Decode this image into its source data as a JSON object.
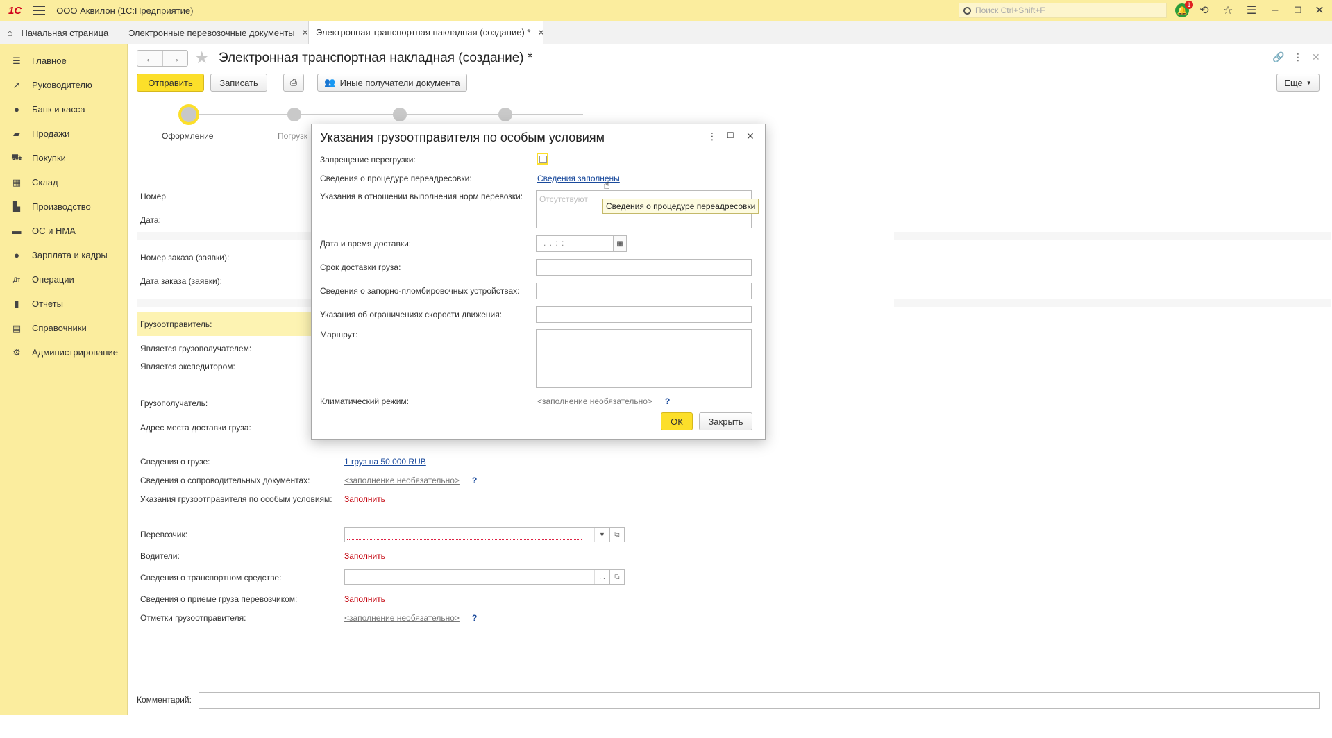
{
  "titlebar": {
    "logo": "1С",
    "app_title": "ООО Аквилон  (1С:Предприятие)",
    "search_placeholder": "Поиск Ctrl+Shift+F",
    "notification_count": "1"
  },
  "tabs": [
    {
      "label": "Начальная страница"
    },
    {
      "label": "Электронные перевозочные документы"
    },
    {
      "label": "Электронная транспортная накладная (создание) *"
    }
  ],
  "sidebar": {
    "items": [
      {
        "label": "Главное",
        "icon": "list-icon"
      },
      {
        "label": "Руководителю",
        "icon": "chart-trend-icon"
      },
      {
        "label": "Банк и касса",
        "icon": "coin-icon"
      },
      {
        "label": "Продажи",
        "icon": "bag-icon"
      },
      {
        "label": "Покупки",
        "icon": "cart-icon"
      },
      {
        "label": "Склад",
        "icon": "grid-icon"
      },
      {
        "label": "Производство",
        "icon": "factory-icon"
      },
      {
        "label": "ОС и НМА",
        "icon": "truck-icon"
      },
      {
        "label": "Зарплата и кадры",
        "icon": "person-icon"
      },
      {
        "label": "Операции",
        "icon": "dt-kt-icon"
      },
      {
        "label": "Отчеты",
        "icon": "bar-chart-icon"
      },
      {
        "label": "Справочники",
        "icon": "book-icon"
      },
      {
        "label": "Администрирование",
        "icon": "gear-icon"
      }
    ]
  },
  "document": {
    "title": "Электронная транспортная накладная (создание) *",
    "buttons": {
      "send": "Отправить",
      "save": "Записать",
      "other_recipients": "Иные получатели документа",
      "more": "Еще"
    },
    "steps": [
      {
        "label": "Оформление"
      },
      {
        "label": "Погрузк"
      }
    ],
    "fields": {
      "number": "Номер",
      "date": "Дата:",
      "order_number": "Номер заказа (заявки):",
      "order_date": "Дата заказа (заявки):",
      "shipper": "Грузоотправитель:",
      "is_consignee": "Является грузополучателем:",
      "is_forwarder": "Является экспедитором:",
      "consignee": "Грузополучатель:",
      "delivery_address": "Адрес места доставки груза:",
      "cargo_info": "Сведения о грузе:",
      "cargo_info_value": "1 груз на 50 000 RUB",
      "accompanying_docs": "Сведения о сопроводительных документах:",
      "accompanying_docs_value": "<заполнение необязательно>",
      "special_conditions": "Указания грузоотправителя по особым условиям:",
      "special_conditions_value": "Заполнить",
      "carrier": "Перевозчик:",
      "drivers": "Водители:",
      "drivers_value": "Заполнить",
      "vehicle": "Сведения о транспортном средстве:",
      "acceptance": "Сведения о приеме груза перевозчиком:",
      "acceptance_value": "Заполнить",
      "shipper_marks": "Отметки грузоотправителя:",
      "shipper_marks_value": "<заполнение необязательно>",
      "comment": "Комментарий:"
    }
  },
  "dialog": {
    "title": "Указания грузоотправителя по особым условиям",
    "fields": {
      "reload_ban": "Запрещение перегрузки:",
      "redirect_info": "Сведения о процедуре переадресовки:",
      "redirect_value": "Сведения заполнены",
      "norms": "Указания в отношении выполнения норм перевозки:",
      "norms_placeholder": "Отсутствуют",
      "delivery_datetime": "Дата и время доставки:",
      "date_mask": ".  .       :  :",
      "delivery_term": "Срок доставки груза:",
      "seal_devices": "Сведения о запорно-пломбировочных устройствах:",
      "speed_limits": "Указания об ограничениях скорости движения:",
      "route": "Маршрут:",
      "climate": "Климатический режим:",
      "climate_value": "<заполнение необязательно>"
    },
    "buttons": {
      "ok": "ОК",
      "close": "Закрыть"
    },
    "tooltip": "Сведения о процедуре переадресовки"
  }
}
